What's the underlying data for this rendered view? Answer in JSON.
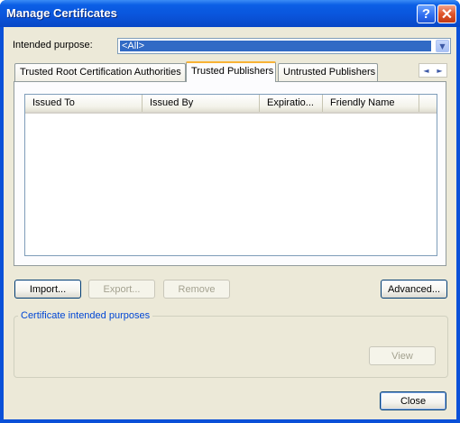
{
  "window": {
    "title": "Manage Certificates",
    "help_glyph": "?",
    "close_glyph": "✕"
  },
  "intended_purpose": {
    "label": "Intended purpose:",
    "selected": "<All>"
  },
  "tabs": [
    {
      "label": "Trusted Root Certification Authorities",
      "active": false
    },
    {
      "label": "Trusted Publishers",
      "active": true
    },
    {
      "label": "Untrusted Publishers",
      "active": false
    }
  ],
  "tab_scroll": {
    "left": "◄",
    "right": "►"
  },
  "list": {
    "columns": [
      "Issued To",
      "Issued By",
      "Expiratio...",
      "Friendly Name"
    ],
    "rows": []
  },
  "buttons": {
    "import": "Import...",
    "export": "Export...",
    "remove": "Remove",
    "advanced": "Advanced...",
    "view": "View",
    "close": "Close"
  },
  "purposes_group": {
    "label": "Certificate intended purposes"
  },
  "colors": {
    "titlebar": "#0a55dc",
    "client_bg": "#ece9d8",
    "selection": "#316ac5",
    "group_label": "#0046d5",
    "active_tab_accent": "#f8b336"
  }
}
